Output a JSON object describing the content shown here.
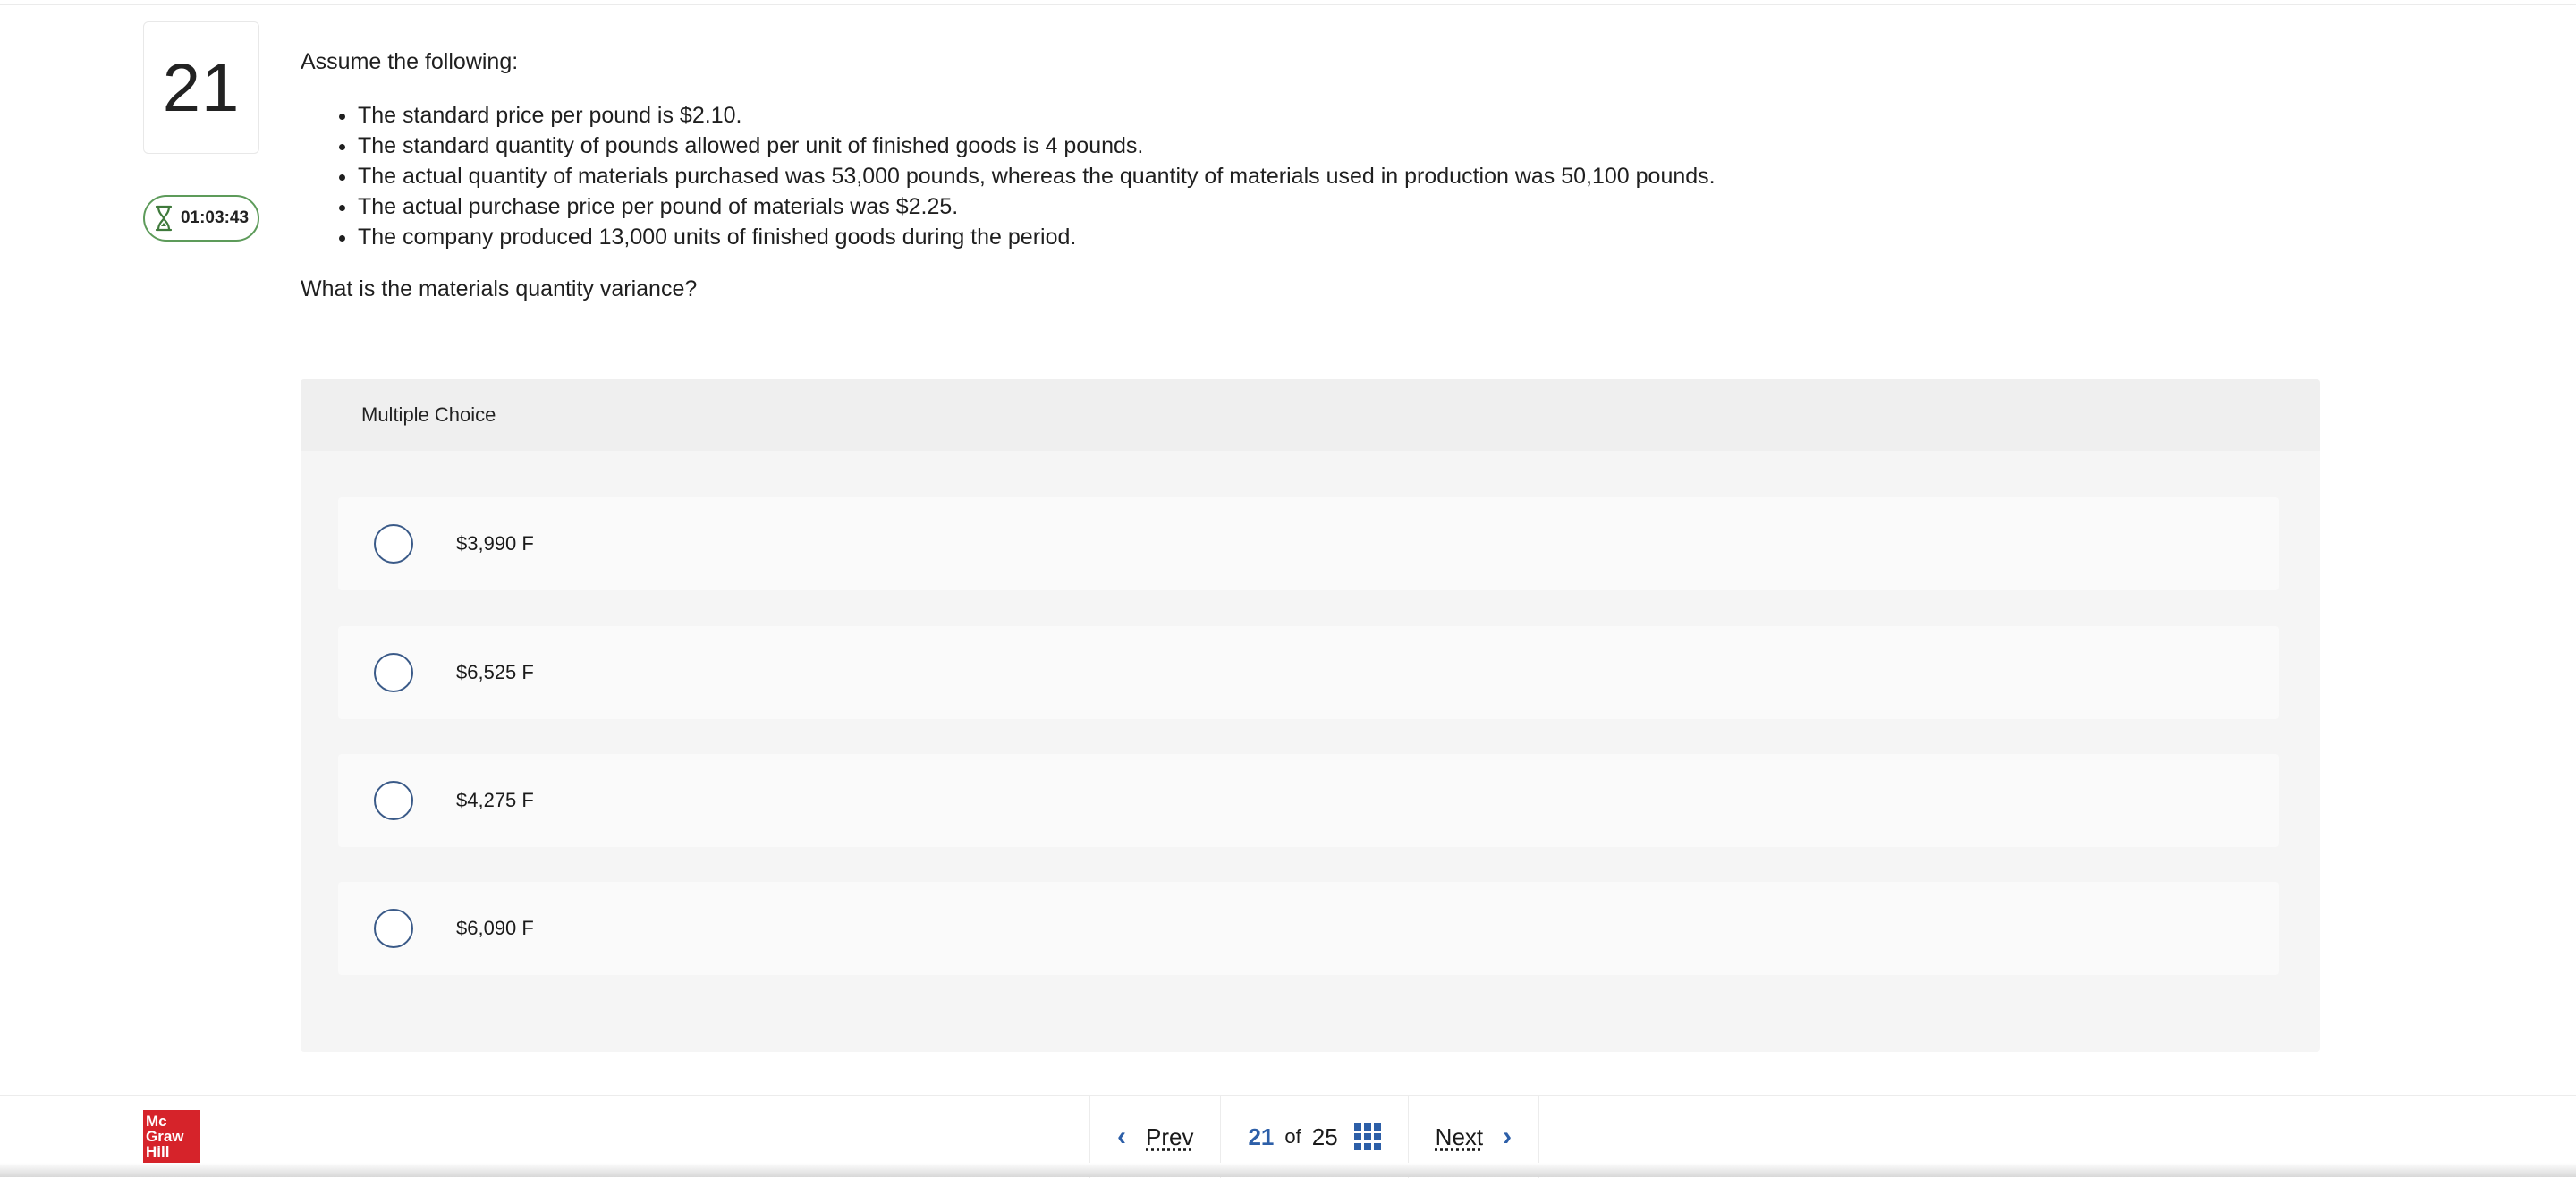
{
  "question": {
    "number": "21",
    "timer": "01:03:43",
    "intro": "Assume the following:",
    "bullets": [
      "The standard price per pound is $2.10.",
      "The standard quantity of pounds allowed per unit of finished goods is 4 pounds.",
      "The actual quantity of materials purchased was 53,000 pounds, whereas the quantity of materials used in production was 50,100 pounds.",
      "The actual purchase price per pound of materials was $2.25.",
      "The company produced 13,000 units of finished goods during the period."
    ],
    "prompt": "What is the materials quantity variance?"
  },
  "answer_panel": {
    "header": "Multiple Choice",
    "choices": [
      "$3,990 F",
      "$6,525 F",
      "$4,275 F",
      "$6,090 F"
    ]
  },
  "footer": {
    "logo_lines": [
      "Mc",
      "Graw",
      "Hill"
    ],
    "prev_label": "Prev",
    "next_label": "Next",
    "current_page": "21",
    "of_label": "of",
    "total_pages": "25"
  },
  "icons": {
    "timer": "hourglass-icon",
    "prev": "chevron-left-icon",
    "next": "chevron-right-icon",
    "overview": "grid-icon"
  },
  "colors": {
    "accent": "#2d5fa8",
    "timer_border": "#5d9b5a",
    "logo": "#d6232a"
  }
}
